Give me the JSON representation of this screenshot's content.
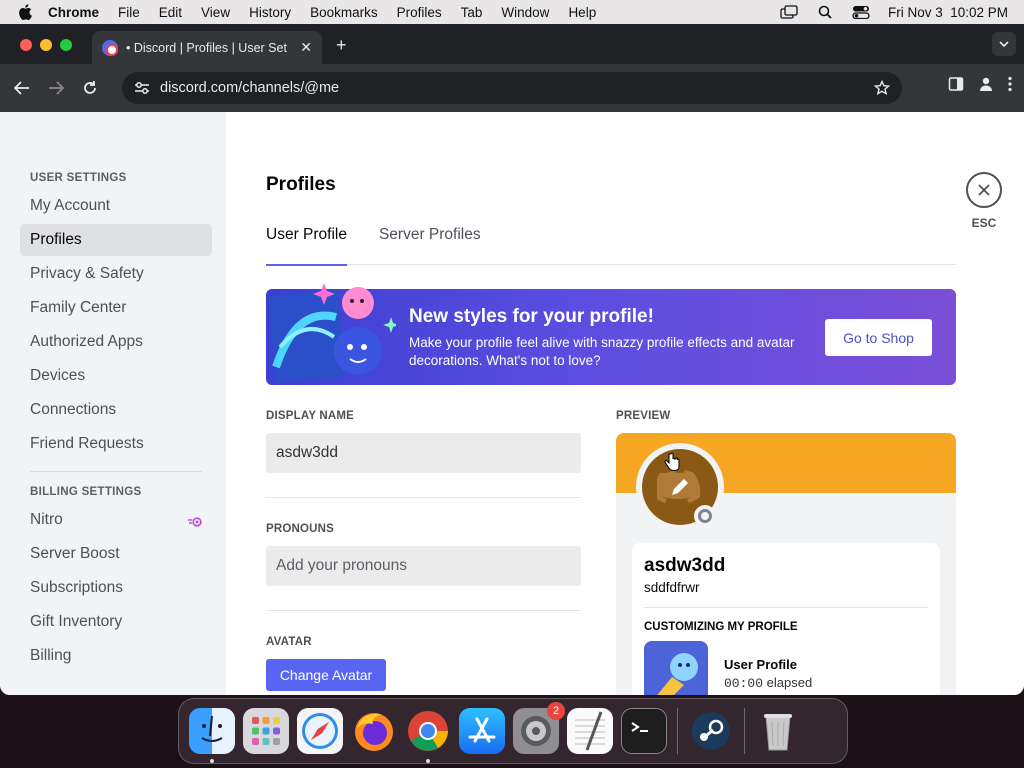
{
  "menubar": {
    "app_name": "Chrome",
    "items": [
      "File",
      "Edit",
      "View",
      "History",
      "Bookmarks",
      "Profiles",
      "Tab",
      "Window",
      "Help"
    ],
    "datetime": "Fri Nov 3  10:02 PM"
  },
  "browser": {
    "tab_title": "• Discord | Profiles | User Set",
    "url": "discord.com/channels/@me"
  },
  "sidebar": {
    "user_settings_header": "User Settings",
    "user_items": [
      "My Account",
      "Profiles",
      "Privacy & Safety",
      "Family Center",
      "Authorized Apps",
      "Devices",
      "Connections",
      "Friend Requests"
    ],
    "billing_header": "Billing Settings",
    "billing_items": [
      "Nitro",
      "Server Boost",
      "Subscriptions",
      "Gift Inventory",
      "Billing"
    ],
    "active_item": "Profiles"
  },
  "main": {
    "title": "Profiles",
    "tabs": [
      "User Profile",
      "Server Profiles"
    ],
    "active_tab": "User Profile",
    "esc_label": "ESC",
    "banner": {
      "title": "New styles for your profile!",
      "description": "Make your profile feel alive with snazzy profile effects and avatar decorations. What's not to love?",
      "button": "Go to Shop"
    },
    "display_name_label": "Display Name",
    "display_name_value": "asdw3dd",
    "pronouns_label": "Pronouns",
    "pronouns_placeholder": "Add your pronouns",
    "avatar_label": "Avatar",
    "change_avatar_button": "Change Avatar"
  },
  "preview": {
    "label": "Preview",
    "banner_color": "#f5a623",
    "display_name": "asdw3dd",
    "username": "sddfdfrwr",
    "section_title": "Customizing My Profile",
    "activity_title": "User Profile",
    "activity_time": "00:00",
    "activity_suffix": "elapsed"
  },
  "colors": {
    "accent": "#5865f2",
    "sidebar_bg": "#f2f3f5",
    "banner_gradient_start": "#3b3fd1",
    "banner_gradient_end": "#7a4fd8"
  },
  "dock": {
    "apps": [
      "finder-icon",
      "launchpad-icon",
      "safari-icon",
      "firefox-icon",
      "chrome-icon",
      "app-store-icon",
      "system-settings-icon",
      "textedit-icon",
      "terminal-icon",
      "steam-icon",
      "trash-icon"
    ],
    "settings_badge": "2"
  }
}
